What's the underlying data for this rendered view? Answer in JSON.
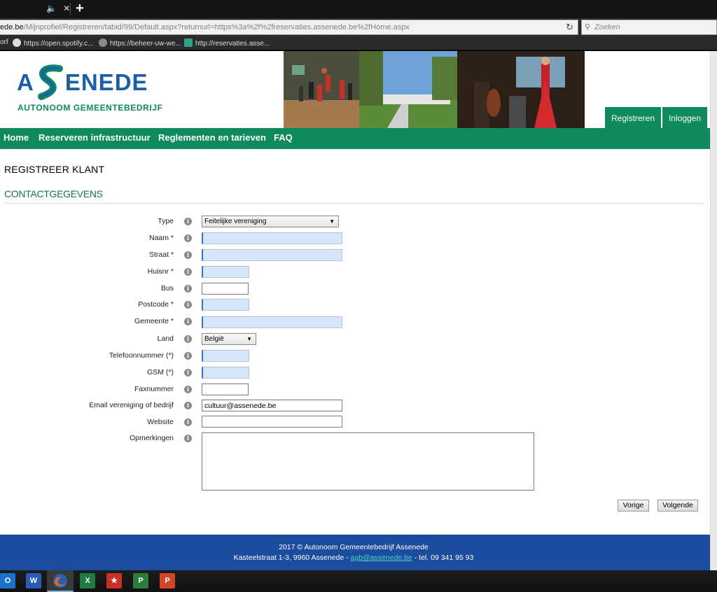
{
  "browser": {
    "tab_controls": {
      "mute": "🔈",
      "close": "✕"
    },
    "new_tab": "+",
    "url": {
      "host": "ede.be",
      "path": "/Mijnprofiel/Registreren/tabid/99/Default.aspx?returnurl=https%3a%2f%2freservaties.assenede.be%2fHome.aspx"
    },
    "reload": "↻",
    "search_placeholder": "Zoeken",
    "bookmarks": [
      {
        "label": "orf"
      },
      {
        "label": "https://open.spotify.c..."
      },
      {
        "label": "https://beheer-uw-we..."
      },
      {
        "label": "http://reservaties.asse..."
      }
    ]
  },
  "site": {
    "logo": {
      "wordmark": "ASSENEDE",
      "subtitle": "AUTONOOM GEMEENTEBEDRIJF"
    },
    "auth": {
      "register": "Registreren",
      "login": "Inloggen"
    },
    "menu": [
      "Home",
      "Reserveren infrastructuur",
      "Reglementen en tarieven",
      "FAQ"
    ],
    "page_title": "REGISTREER KLANT",
    "section_title": "CONTACTGEGEVENS",
    "info_glyph": "i",
    "fields": {
      "type": {
        "label": "Type",
        "value": "Feitelijke vereniging"
      },
      "naam": {
        "label": "Naam *",
        "value": ""
      },
      "straat": {
        "label": "Straat *",
        "value": ""
      },
      "huisnr": {
        "label": "Huisnr *",
        "value": ""
      },
      "bus": {
        "label": "Bus",
        "value": ""
      },
      "postcode": {
        "label": "Postcode *",
        "value": ""
      },
      "gemeente": {
        "label": "Gemeente *",
        "value": ""
      },
      "land": {
        "label": "Land",
        "value": "België"
      },
      "telefoon": {
        "label": "Telefoonnummer (*)",
        "value": ""
      },
      "gsm": {
        "label": "GSM (*)",
        "value": ""
      },
      "fax": {
        "label": "Faxnummer",
        "value": ""
      },
      "email": {
        "label": "Email vereniging of bedrijf",
        "value": "cultuur@assenede.be"
      },
      "website": {
        "label": "Website",
        "value": ""
      },
      "opmerkingen": {
        "label": "Opmerkingen",
        "value": ""
      }
    },
    "buttons": {
      "previous": "Vorige",
      "next": "Volgende"
    },
    "footer": {
      "line1": "2017 © Autonoom Gemeentebedrijf Assenede",
      "address": "Kasteelstraat 1-3, 9960 Assenede  - ",
      "email": "agb@assenede.be",
      "tel": " - tel. 09 341 95 93"
    }
  },
  "taskbar": {
    "apps": [
      {
        "name": "outlook",
        "glyph": "O",
        "color": "#1a73c7"
      },
      {
        "name": "word",
        "glyph": "W",
        "color": "#2b5bb5"
      },
      {
        "name": "firefox",
        "glyph": "",
        "color": "#e8691e"
      },
      {
        "name": "excel",
        "glyph": "X",
        "color": "#1f7a44"
      },
      {
        "name": "app-red",
        "glyph": "★",
        "color": "#c8302a"
      },
      {
        "name": "project",
        "glyph": "P",
        "color": "#2d7d3a"
      },
      {
        "name": "powerpoint",
        "glyph": "P",
        "color": "#d0462a"
      }
    ]
  },
  "colors": {
    "brand_green": "#0f8a5d",
    "brand_blue": "#1b5fa6",
    "footer_blue": "#1b4c9d",
    "required_field": "#d7e7fb"
  }
}
